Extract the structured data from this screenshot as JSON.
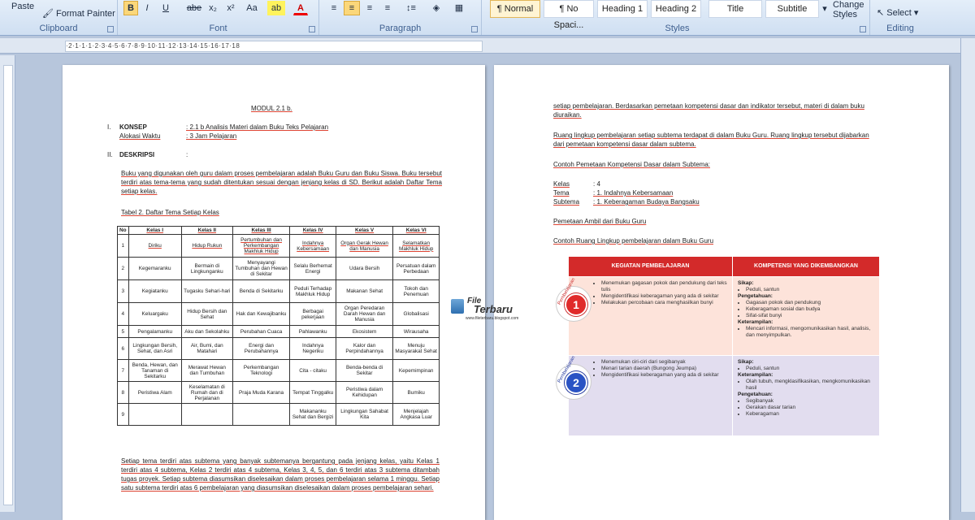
{
  "ribbon": {
    "clipboard": {
      "paste": "Paste",
      "format_painter": "Format Painter",
      "label": "Clipboard"
    },
    "font": {
      "bold": "B",
      "italic": "I",
      "underline": "U",
      "strike": "abe",
      "subscript": "x₂",
      "superscript": "x²",
      "change_case": "Aa",
      "highlight": "ab",
      "font_color": "A",
      "label": "Font"
    },
    "paragraph": {
      "label": "Paragraph"
    },
    "styles": {
      "items": [
        "¶ Normal",
        "¶ No Spaci...",
        "Heading 1",
        "Heading 2",
        "Title",
        "Subtitle"
      ],
      "change_styles": "Change Styles",
      "label": "Styles"
    },
    "editing": {
      "select": "Select",
      "label": "Editing"
    }
  },
  "ruler_text": "·2·1·1·1·2·3·4·5·6·7·8·9·10·11·12·13·14·15·16·17·18",
  "page1": {
    "title": "MODUL 2.1 b.",
    "s1_num": "I.",
    "s1_label": "KONSEP",
    "s1_value": ": 2.1 b Analisis  Materi dalam Buku Teks Pelajaran",
    "alloc_label": "Alokasi Waktu",
    "alloc_value": ": 3 Jam Pelajaran",
    "s2_num": "II.",
    "s2_label": "DESKRIPSI",
    "s2_value": ":",
    "para1": "Buku yang digunakan oleh guru dalam proses pembelajaran adalah Buku Guru dan Buku Siswa. Buku tersebut terdiri atas tema-tema yang sudah ditentukan sesuai dengan jenjang kelas di SD. Berikut adalah Daftar Tema setiap kelas.",
    "table_caption": "Tabel 2. Daftar Tema Setiap Kelas",
    "table_headers": [
      "No",
      "Kelas I",
      "Kelas II",
      "Kelas III",
      "Kelas IV",
      "Kelas V",
      "Kelas VI"
    ],
    "table_rows": [
      [
        "1",
        "Diriku",
        "Hidup Rukun",
        "Pertumbuhan dan Perkembangan Makhluk Hidup",
        "Indahnya Kebersamaan",
        "Organ Gerak Hewan dan Manusia",
        "Selamatkan Makhluk Hidup"
      ],
      [
        "2",
        "Kegemaranku",
        "Bermain di Lingkunganku",
        "Menyayangi Tumbuhan dan Hewan di Sekitar",
        "Selalu Berhemat Energi",
        "Udara Bersih",
        "Persatuan dalam Perbedaan"
      ],
      [
        "3",
        "Kegiatanku",
        "Tugasku Sehari-hari",
        "Benda di Sekitarku",
        "Peduli Terhadap Makhluk Hidup",
        "Makanan Sehat",
        "Tokoh dan Penemuan"
      ],
      [
        "4",
        "Keluargaku",
        "Hidup Bersih dan Sehat",
        "Hak dan Kewajibanku",
        "Berbagai pekerjaan",
        "Organ Peredaran Darah Hewan dan Manusia",
        "Globalisasi"
      ],
      [
        "5",
        "Pengalamanku",
        "Aku dan Sekolahku",
        "Perubahan Cuaca",
        "Pahlawanku",
        "Ekosistem",
        "Wirausaha"
      ],
      [
        "6",
        "Lingkungan Bersih, Sehat, dan Asri",
        "Air, Bumi, dan Matahari",
        "Energi dan Perubahannya",
        "Indahnya Negeriku",
        "Kalor dan Perpindahannya",
        "Menuju Masyarakat Sehat"
      ],
      [
        "7",
        "Benda, Hewan, dan Tanaman di Sekitarku",
        "Merawat Hewan dan Tumbuhan",
        "Perkembangan Teknologi",
        "Cita - citaku",
        "Benda-benda di Sekitar",
        "Kepemimpinan"
      ],
      [
        "8",
        "Peristiwa Alam",
        "Keselamatan di Rumah dan di Perjalanan",
        "Praja Muda Karana",
        "Tempat Tinggalku",
        "Peristiwa dalam Kehidupan",
        "Bumiku"
      ],
      [
        "9",
        "",
        "",
        "",
        "Makananku Sehat dan Bergizi",
        "Lingkungan Sahabat Kita",
        "Menjelajah Angkasa Luar"
      ]
    ],
    "para2": "Setiap tema terdiri atas subtema yang banyak subtemanya bergantung pada jenjang kelas, yaitu Kelas 1 terdiri atas 4 subtema, Kelas 2 terdiri atas 4 subtema, Kelas 3, 4, 5, dan 6 terdiri atas 3 subtema ditambah tugas proyek. Setiap subtema diasumsikan diselesaikan dalam proses pembelajaran selama 1 minggu. Setiap satu subtema terdiri atas 6 pembelajaran yang diasumsikan diselesaikan dalam proses pembelajaran sehari."
  },
  "page2": {
    "p1": "setiap pembelajaran. Berdasarkan pemetaan kompetensi dasar dan indikator tersebut, materi di dalam buku diuraikan.",
    "p2": "Ruang lingkup pembelajaran setiap subtema terdapat di dalam Buku Guru. Ruang lingkup tersebut dijabarkan dari pemetaan kompetensi dasar dalam subtema.",
    "p3": "Contoh Pemetaan Kompetensi Dasar dalam Subtema:",
    "kelas_label": "Kelas",
    "kelas_value": ": 4",
    "tema_label": "Tema",
    "tema_value": ": 1. Indahnya Kebersamaan",
    "subtema_label": "Subtema",
    "subtema_value": ": 1. Keberagaman Budaya Bangsaku",
    "p4": "Pemetaan Ambil dari Buku Guru",
    "p5": "Contoh Ruang Lingkup pembelajaran  dalam Buku Guru",
    "k_head_left": "KEGIATAN PEMBELAJARAN",
    "k_head_right": "KOMPETENSI YANG DIKEMBANGKAN",
    "badge_word": "Pembelajaran",
    "badge1": "1",
    "badge2": "2",
    "k1_left": [
      "Menemukan gagasan pokok dan pendukung dari teks tulis",
      "Mengidentifikasi keberagaman yang ada di sekitar",
      "Melakukan percobaan cara menghasilkan bunyi"
    ],
    "k1_sikap": "Sikap:",
    "k1_sikap_items": [
      "Peduli, santun"
    ],
    "k1_peng": "Pengetahuan:",
    "k1_peng_items": [
      "Gagasan pokok dan pendukung",
      "Keberagaman sosial dan budya",
      "Sifat-sifat bunyi"
    ],
    "k1_ket": "Keterampilan:",
    "k1_ket_items": [
      "Mencari informasi, mengomunikasikan hasil, analisis, dan menyimpulkan."
    ],
    "k2_left": [
      "Menemukan ciri-ciri dari segibanyak",
      "Menari tarian daerah (Bungong Jeumpa)",
      "Mengidentifikasi keberagaman yang ada di sekitar"
    ],
    "k2_sikap": "Sikap:",
    "k2_sikap_items": [
      "Peduli, santun"
    ],
    "k2_ket": "Keterampilan:",
    "k2_ket_items": [
      "Olah tubuh, mengklasifikasikan, mengkomunikasikan hasil"
    ],
    "k2_peng": "Pengetahuan:",
    "k2_peng_items": [
      "Segibanyak",
      "Gerakan dasar tarian",
      "Keberagaman"
    ]
  },
  "watermark": {
    "line1": "File",
    "line2": "Terbaru",
    "url": "www.fileterbaru.blogspot.com"
  }
}
